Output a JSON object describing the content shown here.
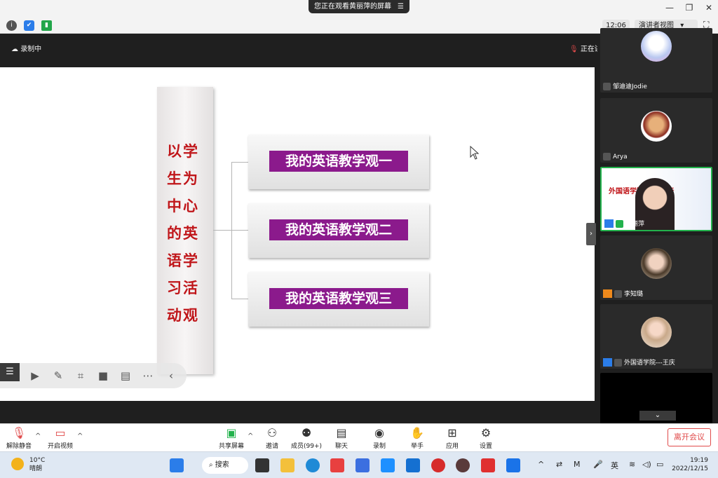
{
  "window": {
    "share_banner": "您正在观看黄丽萍的屏幕",
    "share_menu_icon": "menu-lines-icon",
    "controls": [
      "minimize",
      "restore",
      "close"
    ]
  },
  "toolbar": {
    "time": "12:06",
    "view_mode": "演讲者视图",
    "icons": [
      "info-icon",
      "shield-icon",
      "signal-icon"
    ]
  },
  "meeting_bar": {
    "recording": "录制中",
    "speaking": "正在讲话: 黄丽萍"
  },
  "slide": {
    "vertical_title": "以学生为中心的英语学习活动观",
    "items": [
      "我的英语教学观一",
      "我的英语教学观二",
      "我的英语教学观三"
    ]
  },
  "participants": [
    {
      "name": "邹迪迪Jodie",
      "status": "mic-muted"
    },
    {
      "name": "Arya",
      "status": "mic-muted"
    },
    {
      "name": "黄丽萍",
      "status": "speaking",
      "banner": "外国语学院  名师讲坛"
    },
    {
      "name": "李知璐",
      "status": "mic-muted"
    },
    {
      "name": "外国语学院---王庆",
      "status": "mic-muted"
    }
  ],
  "controls": {
    "unmute": "解除静音",
    "start_video": "开启视频",
    "share_screen": "共享屏幕",
    "invite": "邀请",
    "members": "成员(99+)",
    "chat": "聊天",
    "record": "录制",
    "raise_hand": "举手",
    "apps": "应用",
    "settings": "设置",
    "leave": "离开会议"
  },
  "taskbar": {
    "temperature": "10°C",
    "weather": "晴朗",
    "search": "搜索",
    "ime": "英",
    "time": "19:19",
    "date": "2022/12/15"
  }
}
